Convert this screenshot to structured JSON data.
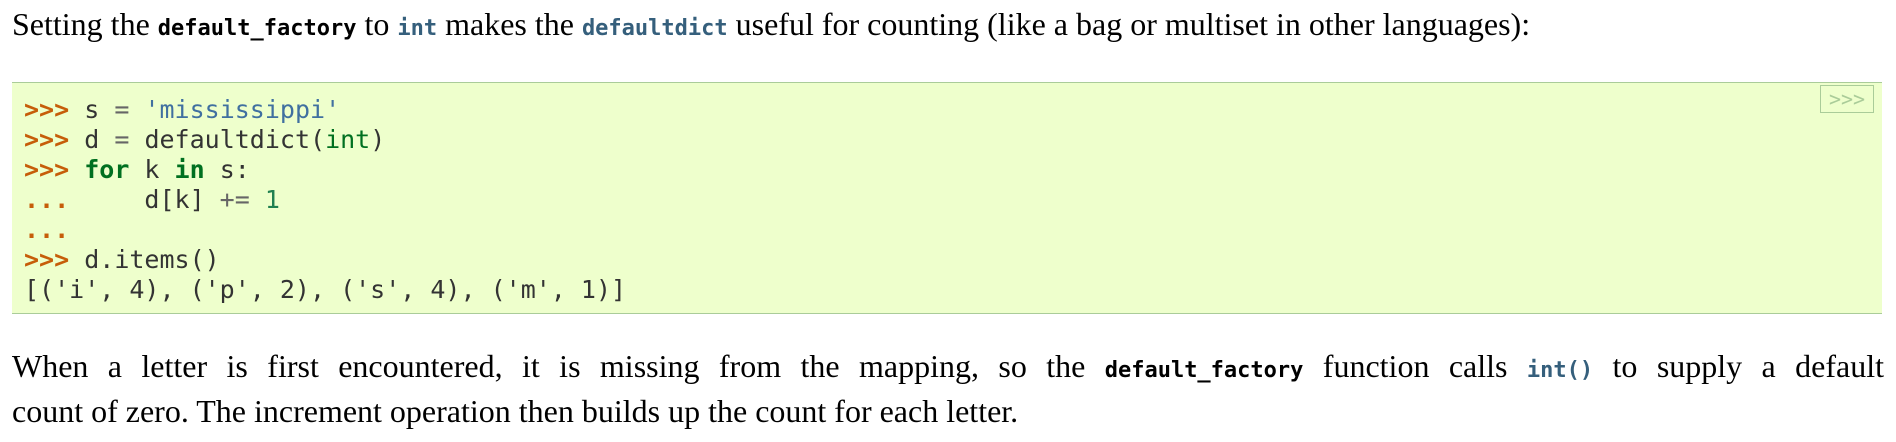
{
  "intro": {
    "text_1": "Setting the ",
    "code_default_factory": "default_factory",
    "text_2": " to ",
    "code_int": "int",
    "text_3": " makes the ",
    "code_defaultdict": "defaultdict",
    "text_4": " useful for counting (like a bag or multiset in other languages):"
  },
  "code_block": {
    "toggle_label": ">>>",
    "lines": [
      {
        "prompt": ">>> ",
        "parts": [
          "s ",
          "=",
          " ",
          "'mississippi'"
        ]
      },
      {
        "prompt": ">>> ",
        "parts": [
          "d ",
          "=",
          " defaultdict(",
          "int",
          ")"
        ]
      },
      {
        "prompt": ">>> ",
        "parts": [
          "for",
          " k ",
          "in",
          " s:"
        ]
      },
      {
        "prompt": "...",
        "parts": [
          "     d[k] ",
          "+=",
          " ",
          "1"
        ]
      },
      {
        "prompt": "...",
        "parts": []
      },
      {
        "prompt": ">>> ",
        "parts": [
          "d.items()"
        ]
      },
      {
        "prompt": "",
        "parts": [
          "[('i', 4), ('p', 2), ('s', 4), ('m', 1)]"
        ]
      }
    ]
  },
  "explanation": {
    "text_1": "When a letter is first encountered, it is missing from the mapping, so the ",
    "code_default_factory": "default_factory",
    "text_2": " function calls ",
    "code_int_call": "int()",
    "text_3": " to supply a default",
    "text_4": "count of zero. The increment operation then builds up the count for each letter."
  },
  "colors": {
    "code_background": "#eeffcc",
    "code_border": "#aacc99",
    "prompt": "#c65d09",
    "keyword": "#007020",
    "string": "#4070a0",
    "number": "#208050",
    "link_code": "#355f7c"
  }
}
